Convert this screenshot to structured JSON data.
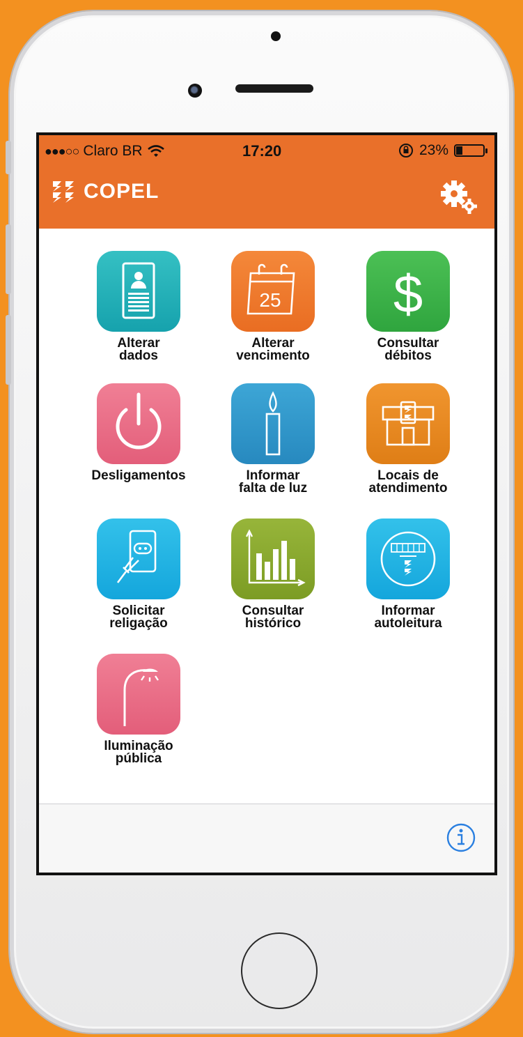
{
  "status_bar": {
    "signal": "●●●○○",
    "carrier": "Claro BR",
    "wifi_icon": "wifi-icon",
    "time": "17:20",
    "orientation_lock_icon": "rotation-lock-icon",
    "battery_percent": "23%",
    "battery_level": 0.23
  },
  "nav": {
    "title": "COPEL",
    "logo_icon": "copel-logo",
    "settings_icon": "gears-icon"
  },
  "colors": {
    "brand_orange": "#e9702a",
    "background_orange": "#f39120"
  },
  "tiles": [
    {
      "label": "Alterar\ndados",
      "icon": "document-person-icon",
      "color": "#1fb0b7"
    },
    {
      "label": "Alterar\nvencimento",
      "icon": "calendar-icon",
      "color": "#ef7b2c"
    },
    {
      "label": "Consultar\ndébitos",
      "icon": "dollar-icon",
      "color": "#3fb24a"
    },
    {
      "label": "Desligamentos",
      "icon": "power-icon",
      "color": "#ec6d86"
    },
    {
      "label": "Informar\nfalta de luz",
      "icon": "candle-icon",
      "color": "#2f98cc"
    },
    {
      "label": "Locais de\natendimento",
      "icon": "store-icon",
      "color": "#ea8a25"
    },
    {
      "label": "Solicitar\nreligação",
      "icon": "plug-icon",
      "color": "#22b5e5"
    },
    {
      "label": "Consultar\nhistórico",
      "icon": "bar-chart-icon",
      "color": "#8aaa2c"
    },
    {
      "label": "Informar\nautoleitura",
      "icon": "meter-icon",
      "color": "#22b5e5"
    },
    {
      "label": "Iluminação\npública",
      "icon": "street-light-icon",
      "color": "#ec6d86"
    }
  ],
  "calendar_day": "25",
  "footer": {
    "info_icon": "info-icon"
  }
}
